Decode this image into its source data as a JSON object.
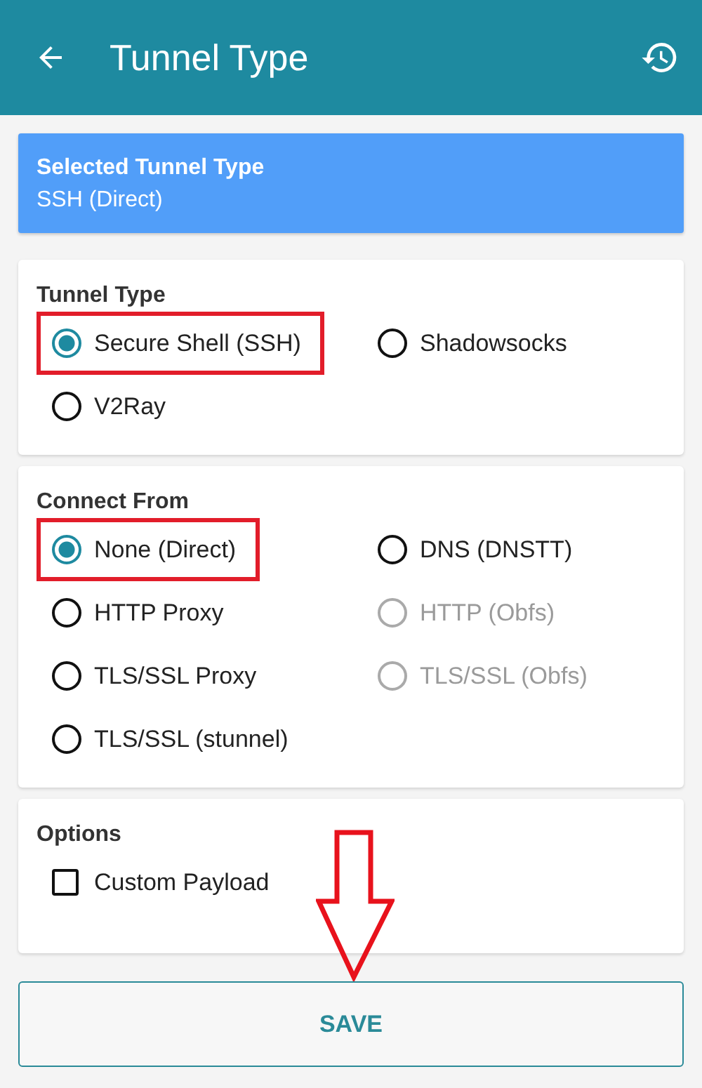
{
  "app_bar": {
    "title": "Tunnel Type"
  },
  "summary": {
    "heading": "Selected Tunnel Type",
    "value": "SSH (Direct)"
  },
  "sections": [
    {
      "title": "Tunnel Type",
      "kind": "radio",
      "options": [
        {
          "label": "Secure Shell (SSH)",
          "selected": true,
          "disabled": false,
          "highlighted": true
        },
        {
          "label": "Shadowsocks",
          "selected": false,
          "disabled": false,
          "highlighted": false
        },
        {
          "label": "V2Ray",
          "selected": false,
          "disabled": false,
          "highlighted": false
        }
      ]
    },
    {
      "title": "Connect From",
      "kind": "radio",
      "options": [
        {
          "label": "None (Direct)",
          "selected": true,
          "disabled": false,
          "highlighted": true
        },
        {
          "label": "DNS (DNSTT)",
          "selected": false,
          "disabled": false,
          "highlighted": false
        },
        {
          "label": "HTTP Proxy",
          "selected": false,
          "disabled": false,
          "highlighted": false
        },
        {
          "label": "HTTP (Obfs)",
          "selected": false,
          "disabled": true,
          "highlighted": false
        },
        {
          "label": "TLS/SSL Proxy",
          "selected": false,
          "disabled": false,
          "highlighted": false
        },
        {
          "label": "TLS/SSL (Obfs)",
          "selected": false,
          "disabled": true,
          "highlighted": false
        },
        {
          "label": "TLS/SSL (stunnel)",
          "selected": false,
          "disabled": false,
          "highlighted": false
        }
      ]
    },
    {
      "title": "Options",
      "kind": "checkbox",
      "options": [
        {
          "label": "Custom Payload",
          "checked": false
        }
      ]
    }
  ],
  "save_button": {
    "label": "SAVE"
  },
  "annotation_arrow": {
    "shown": true
  }
}
